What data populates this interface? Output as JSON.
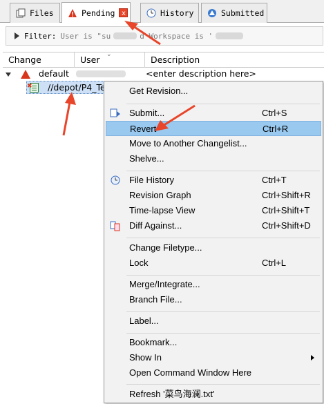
{
  "tabs": [
    {
      "label": "Files",
      "icon": "files-icon"
    },
    {
      "label": "Pending",
      "icon": "pending-warning-icon",
      "close": "x"
    },
    {
      "label": "History",
      "icon": "history-icon"
    },
    {
      "label": "Submitted",
      "icon": "submitted-icon"
    }
  ],
  "filter": {
    "label": "Filter:",
    "text_start": "User is \"su",
    "text_mid": "d Workspace is '"
  },
  "table": {
    "columns": [
      "Change",
      "User",
      "Description"
    ],
    "rows": [
      {
        "change": "default",
        "description": "<enter description here>"
      }
    ],
    "file": "//depot/P4_Te"
  },
  "menu": {
    "items": [
      {
        "label": "Get Revision...",
        "shortcut": ""
      },
      {
        "label": "Submit...",
        "shortcut": "Ctrl+S"
      },
      {
        "label": "Revert",
        "shortcut": "Ctrl+R"
      },
      {
        "label": "Move to Another Changelist...",
        "shortcut": ""
      },
      {
        "label": "Shelve...",
        "shortcut": ""
      },
      {
        "label": "File History",
        "shortcut": "Ctrl+T"
      },
      {
        "label": "Revision Graph",
        "shortcut": "Ctrl+Shift+R"
      },
      {
        "label": "Time-lapse View",
        "shortcut": "Ctrl+Shift+T"
      },
      {
        "label": "Diff Against...",
        "shortcut": "Ctrl+Shift+D"
      },
      {
        "label": "Change Filetype...",
        "shortcut": ""
      },
      {
        "label": "Lock",
        "shortcut": "Ctrl+L"
      },
      {
        "label": "Merge/Integrate...",
        "shortcut": ""
      },
      {
        "label": "Branch File...",
        "shortcut": ""
      },
      {
        "label": "Label...",
        "shortcut": ""
      },
      {
        "label": "Bookmark...",
        "shortcut": ""
      },
      {
        "label": "Show In",
        "shortcut": ""
      },
      {
        "label": "Open Command Window Here",
        "shortcut": ""
      },
      {
        "label": "Refresh '菜鸟海澜.txt'",
        "shortcut": ""
      }
    ],
    "highlighted": "Revert"
  },
  "colors": {
    "highlight": "#99c9ef",
    "annotation": "#e8452a",
    "warning": "#d8361c"
  }
}
